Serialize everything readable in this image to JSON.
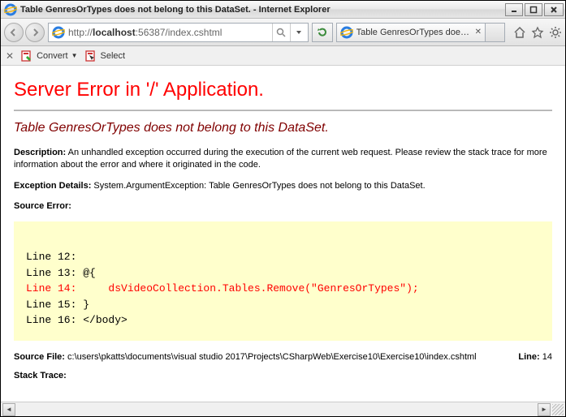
{
  "window": {
    "title": "Table GenresOrTypes does not belong to this DataSet. - Internet Explorer"
  },
  "address_bar": {
    "scheme": "http://",
    "host": "localhost",
    "rest": ":56387/index.cshtml"
  },
  "tab": {
    "label": "Table GenresOrTypes does n..."
  },
  "command_bar": {
    "convert": "Convert",
    "select": "Select"
  },
  "error_page": {
    "h1": "Server Error in '/' Application.",
    "h2": "Table GenresOrTypes does not belong to this DataSet.",
    "description_label": "Description:",
    "description_text": "An unhandled exception occurred during the execution of the current web request. Please review the stack trace for more information about the error and where it originated in the code.",
    "exception_label": "Exception Details:",
    "exception_text": "System.ArgumentException: Table GenresOrTypes does not belong to this DataSet.",
    "source_error_label": "Source Error:",
    "source_lines": {
      "l12": "Line 12:",
      "l13": "Line 13: @{",
      "l14": "Line 14:     dsVideoCollection.Tables.Remove(\"GenresOrTypes\");",
      "l15": "Line 15: }",
      "l16": "Line 16: </body>"
    },
    "source_file_label": "Source File:",
    "source_file": "c:\\users\\pkatts\\documents\\visual studio 2017\\Projects\\CSharpWeb\\Exercise10\\Exercise10\\index.cshtml",
    "line_label": "Line:",
    "line_number": "14",
    "stack_trace_label": "Stack Trace:"
  }
}
